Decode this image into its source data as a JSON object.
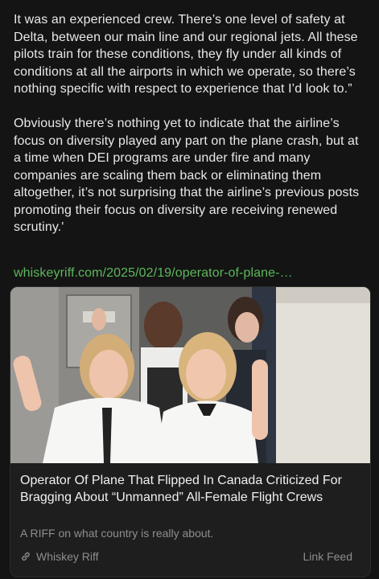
{
  "post": {
    "paragraphs": [
      "It was an experienced crew. There’s one level of safety at Delta, between our main line and our regional jets. All these pilots train for these conditions, they fly under all kinds of conditions at all the airports in which we operate, so there’s nothing specific with respect to experience that I’d look to.”",
      "Obviously there’s nothing yet to indicate that the airline’s focus on diversity played any part on the plane crash, but at a time when DEI programs are under fire and many companies are scaling them back or eliminating them altogether, it’s not surprising that the airline’s previous posts promoting their focus on diversity are receiving renewed scrutiny.'"
    ],
    "link_text": "whiskeyriff.com/2025/02/19/operator-of-plane-…"
  },
  "card": {
    "title": "Operator Of Plane That Flipped In Canada Criticized For Bragging About “Unmanned” All-Female Flight Crews",
    "description": "A RIFF on what country is really about.",
    "source": "Whiskey Riff",
    "feed_label": "Link Feed",
    "source_icon": "link-icon",
    "image": "photo of four smiling female flight crew members posing in an aircraft galley"
  },
  "colors": {
    "background": "#141414",
    "text": "#e8e8e8",
    "link": "#5cb85c",
    "card_background": "#1e1e1e",
    "muted": "#8e8e8e"
  }
}
